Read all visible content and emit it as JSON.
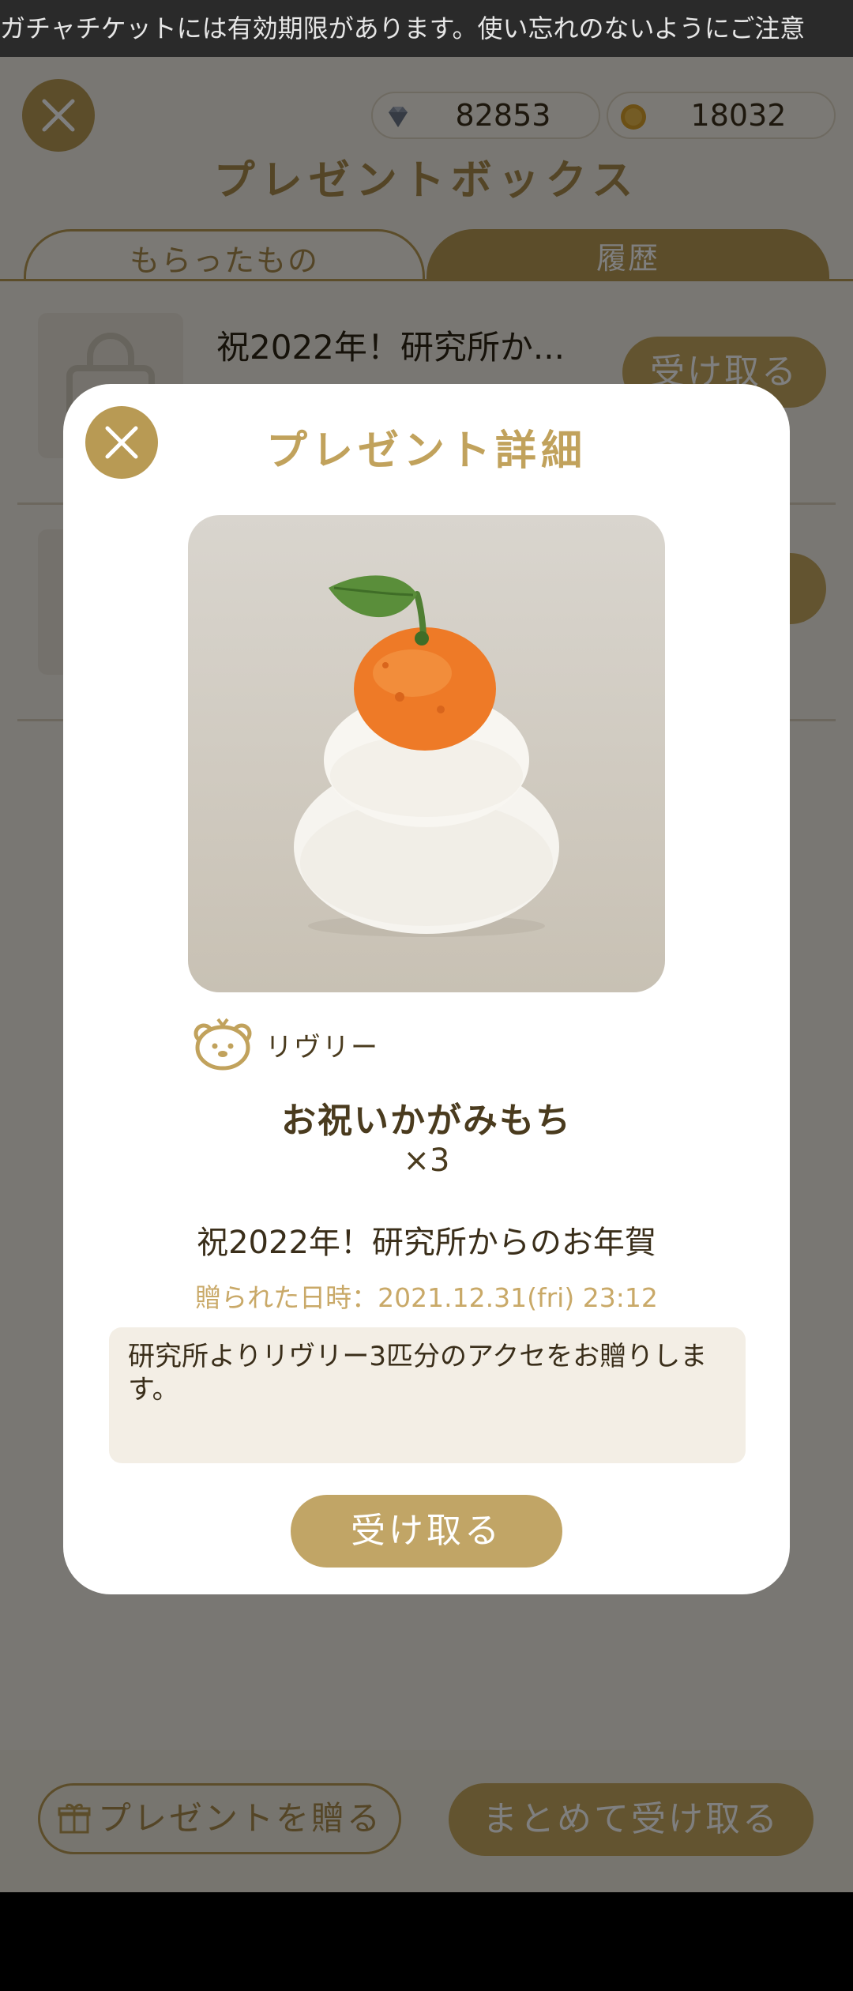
{
  "ticker": {
    "text": "ガチャチケットには有効期限があります。使い忘れのないようにご注意"
  },
  "currencies": [
    {
      "icon": "diamond-icon",
      "value": "82853"
    },
    {
      "icon": "coin-icon",
      "value": "18032"
    }
  ],
  "page_title": "プレゼントボックス",
  "tabs": [
    {
      "label": "もらったもの",
      "active": true
    },
    {
      "label": "履歴",
      "active": false
    }
  ],
  "list": {
    "items": [
      {
        "title": "祝2022年！研究所か...",
        "button_label": "受け取る"
      }
    ]
  },
  "bottom": {
    "send_label": "プレゼントを贈る",
    "bulk_label": "まとめて受け取る"
  },
  "modal": {
    "title": "プレゼント詳細",
    "character_name": "リヴリー",
    "item_name": "お祝いかがみもち",
    "quantity": "×3",
    "gift_title": "祝2022年！研究所からのお年賀",
    "date_text": "贈られた日時：2021.12.31(fri) 23:12",
    "message": "研究所よりリヴリー3匹分のアクセをお贈りします。",
    "accept_label": "受け取る"
  },
  "colors": {
    "accent": "#b89a54",
    "accent_button": "#c1a566",
    "modal_bg": "#ffffff"
  }
}
